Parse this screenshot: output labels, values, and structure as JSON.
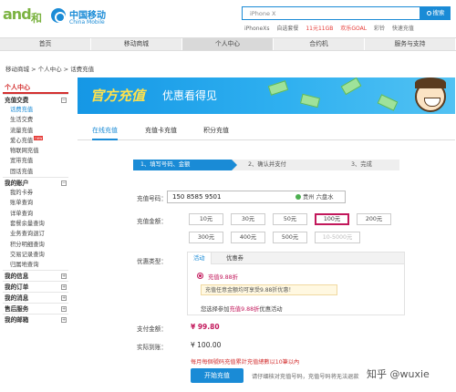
{
  "brand": {
    "and_logo": "and",
    "he": "和",
    "cn": "中国移动",
    "en": "China Mobile"
  },
  "search": {
    "value": "iPhone X",
    "button": "搜索"
  },
  "hotwords": [
    "iPhoneXs",
    "自选套餐",
    "11元11GB",
    "欢乐GOAL",
    "彩铃",
    "快速充值"
  ],
  "nav": [
    "首页",
    "移动商城",
    "个人中心",
    "合约机",
    "服务与支持"
  ],
  "nav_active_index": 2,
  "breadcrumb": "移动商城 > 个人中心 > 话费充值",
  "sidebar": {
    "title": "个人中心",
    "groups": [
      {
        "label": "充值交费",
        "items": [
          "话费充值",
          "生活交费",
          "流量充值",
          "爱心充值",
          "物联网充值",
          "宽带充值",
          "固话充值"
        ]
      },
      {
        "label": "我的账户",
        "items": [
          "我的卡券",
          "账单查询",
          "详单查询",
          "套餐余量查询",
          "业务查询退订",
          "积分明细查询",
          "交易记录查询",
          "归属地查询"
        ]
      },
      {
        "label": "我的信息",
        "items": []
      },
      {
        "label": "我的订单",
        "items": []
      },
      {
        "label": "我的消息",
        "items": []
      },
      {
        "label": "售后服务",
        "items": []
      },
      {
        "label": "我的邮箱",
        "items": []
      }
    ],
    "new_badge": "new"
  },
  "banner": {
    "title": "官方充值",
    "subtitle": "优惠看得见"
  },
  "tabs": [
    "在线充值",
    "充值卡充值",
    "积分充值"
  ],
  "steps": [
    "1、填写号码、金额",
    "2、确认并支付",
    "3、完成"
  ],
  "form": {
    "phone_label": "充值号码：",
    "phone_value": "150 8585 9501",
    "location": "贵州 六盘水",
    "amount_label": "充值金额：",
    "amounts": [
      "10元",
      "30元",
      "50元",
      "100元",
      "200元",
      "300元",
      "400元",
      "500元",
      "10-5000元"
    ],
    "selected_amount": "100元",
    "discount_label": "优惠类型：",
    "discount_tabs": [
      "活动",
      "优惠券"
    ],
    "discount_name": "充值9.88折",
    "discount_note": "充值任意金额均可享受9.88折优惠！",
    "join_prefix": "您选择参加",
    "join_highlight": "充值9.88折",
    "join_suffix": "优惠活动",
    "pay_label": "支付金额：",
    "pay_value": "¥ 99.80",
    "actual_label": "实际到账：",
    "actual_value": "¥ 100.00",
    "warning": "每月每個號码充值累計充值總數以10筆以內",
    "submit": "开始充值",
    "hint": "请仔细核对充值号码，充值号码将无法退款"
  },
  "watermark": "知乎 @wuxie"
}
